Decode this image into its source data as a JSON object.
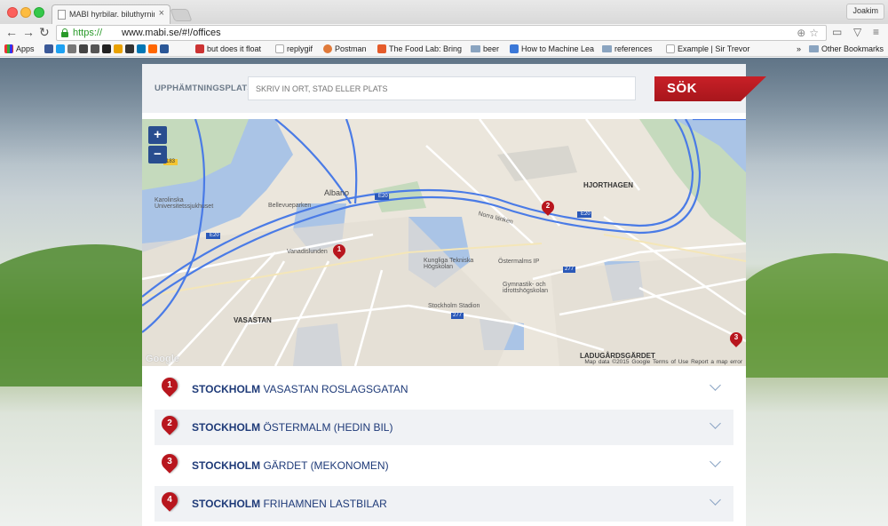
{
  "browser": {
    "tab_title": "MABI hyrbilar. biluthyrning",
    "tab_close": "×",
    "url_scheme": "https://",
    "url_rest": "www.mabi.se/#!/offices",
    "profile_name": "Joakim",
    "bookmarks": [
      {
        "label": "Apps",
        "icon": "apps-icon"
      },
      {
        "label": "but does it float",
        "icon": "site-icon"
      },
      {
        "label": "replygif",
        "icon": "page-icon"
      },
      {
        "label": "Postman",
        "icon": "postman-icon"
      },
      {
        "label": "The Food Lab: Bring",
        "icon": "foodlab-icon"
      },
      {
        "label": "beer",
        "icon": "folder-icon"
      },
      {
        "label": "How to Machine Lea",
        "icon": "site-icon"
      },
      {
        "label": "references",
        "icon": "folder-icon"
      },
      {
        "label": "Example | Sir Trevor",
        "icon": "page-icon"
      },
      {
        "label": "»",
        "icon": ""
      },
      {
        "label": "Other Bookmarks",
        "icon": "folder-icon"
      }
    ]
  },
  "search": {
    "label": "UPPHÄMTNINGSPLATS",
    "placeholder": "SKRIV IN ORT, STAD ELLER PLATS",
    "button_label": "SÖK",
    "button_color": "#b8161e"
  },
  "map": {
    "zoom_in": "+",
    "zoom_out": "−",
    "google": "Google",
    "footer": "Map data ©2015 Google   Terms of Use   Report a map error",
    "labels": {
      "albano": "Albano",
      "hjorthagen": "HJORTHAGEN",
      "vasastan": "VASASTAN",
      "ladugardsgardet": "LADUGÅRDSGÄRDET",
      "karolinska": "Karolinska Universitetssjukhuset",
      "bellevue": "Bellevueparken",
      "vanadis": "Vanadislunden",
      "kth": "Kungliga Tekniska Högskolan",
      "ostermalm_ip": "Östermalms IP",
      "gymnastik": "Gymnastik- och idrottshögskolan",
      "stadion": "Stockholm Stadion",
      "norra_lanken": "Norra länken",
      "e20": "E20",
      "r277": "277",
      "r183": "183"
    },
    "pins": [
      "1",
      "2",
      "3"
    ]
  },
  "offices": [
    {
      "num": "1",
      "city": "STOCKHOLM",
      "place": " VASASTAN ROSLAGSGATAN"
    },
    {
      "num": "2",
      "city": "STOCKHOLM",
      "place": " ÖSTERMALM (HEDIN BIL)"
    },
    {
      "num": "3",
      "city": "STOCKHOLM",
      "place": " GÄRDET (MEKONOMEN)"
    },
    {
      "num": "4",
      "city": "STOCKHOLM",
      "place": " FRIHAMNEN LASTBILAR"
    }
  ]
}
